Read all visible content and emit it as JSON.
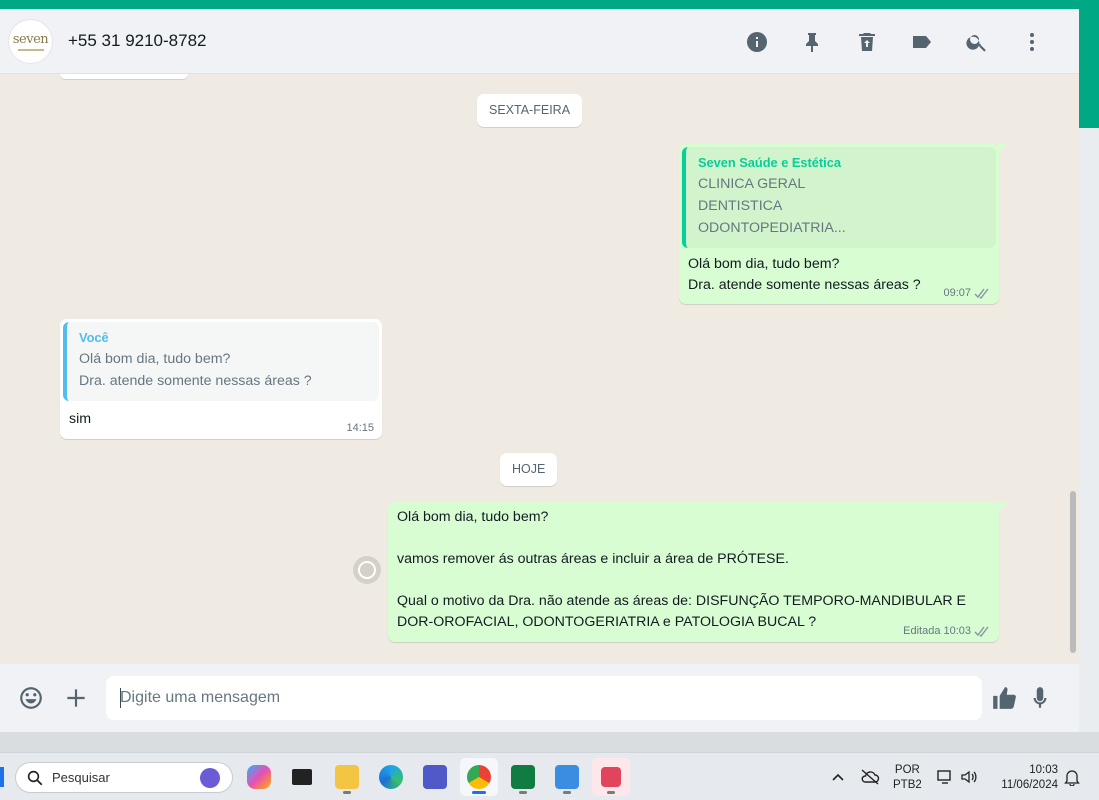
{
  "header": {
    "avatar_text": "seven",
    "contact": "+55 31 9210-8782",
    "icons": [
      "info-icon",
      "pin-icon",
      "delete-icon",
      "label-icon",
      "search-icon",
      "menu-icon"
    ]
  },
  "messages": {
    "date_friday": "SEXTA-FEIRA",
    "date_today": "HOJE",
    "msg1": {
      "quote_author": "Seven Saúde e Estética",
      "quote_lines": [
        "CLINICA GERAL",
        "DENTISTICA",
        "ODONTOPEDIATRIA..."
      ],
      "text": "Olá bom dia, tudo bem?\nDra. atende somente nessas áreas ?",
      "time": "09:07"
    },
    "msg2": {
      "quote_author": "Você",
      "quote_lines": [
        "Olá bom dia, tudo bem?",
        "Dra. atende somente nessas áreas ?"
      ],
      "text": "sim",
      "time": "14:15"
    },
    "msg3": {
      "text": "Olá bom dia, tudo bem?\n\nvamos remover ás outras áreas e incluir a área de PRÓTESE.\n\nQual o motivo da Dra. não atende as áreas de: DISFUNÇÃO TEMPORO-MANDIBULAR E DOR-OROFACIAL, ODONTOGERIATRIA e PATOLOGIA BUCAL ?",
      "edited": "Editada",
      "time": "10:03"
    }
  },
  "composer": {
    "placeholder": "Digite uma mensagem"
  },
  "taskbar": {
    "search_label": "Pesquisar",
    "lang_line1": "POR",
    "lang_line2": "PTB2",
    "time": "10:03",
    "date": "11/06/2024"
  },
  "colors": {
    "accent": "#00a884",
    "bubble_out": "#d9fdd3",
    "bubble_in": "#ffffff",
    "chat_bg": "#efeae2"
  }
}
